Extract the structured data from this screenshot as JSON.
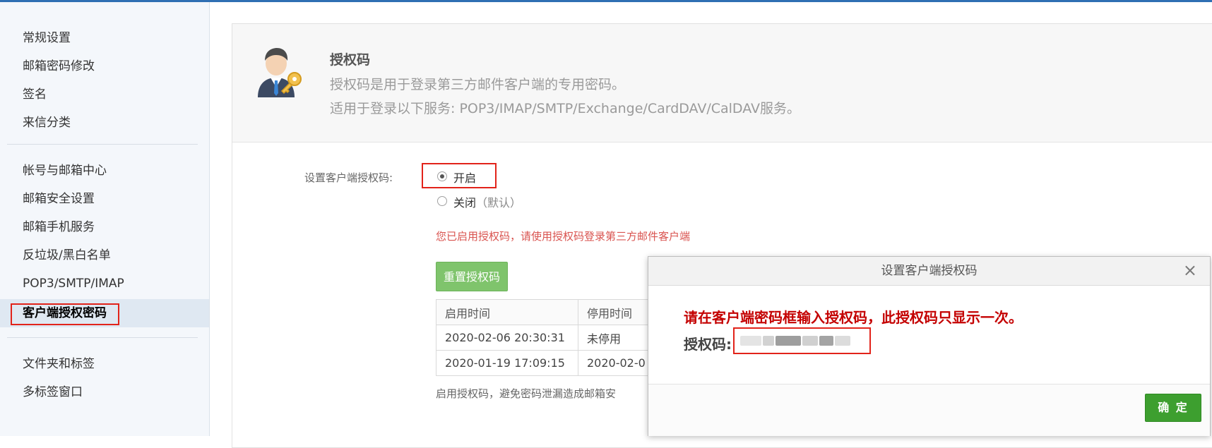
{
  "sidebar": {
    "group1": [
      "常规设置",
      "邮箱密码修改",
      "签名",
      "来信分类"
    ],
    "group2": [
      "帐号与邮箱中心",
      "邮箱安全设置",
      "邮箱手机服务",
      "反垃圾/黑白名单",
      "POP3/SMTP/IMAP",
      "客户端授权密码"
    ],
    "group3": [
      "文件夹和标签",
      "多标签窗口"
    ],
    "active": "客户端授权密码"
  },
  "header": {
    "title": "授权码",
    "desc1": "授权码是用于登录第三方邮件客户端的专用密码。",
    "desc2": "适用于登录以下服务: POP3/IMAP/SMTP/Exchange/CardDAV/CalDAV服务。"
  },
  "setting": {
    "label": "设置客户端授权码:",
    "on_label": "开启",
    "off_label": "关闭",
    "off_default": "（默认）",
    "selected": "开启",
    "notice": "您已启用授权码，请使用授权码登录第三方邮件客户端",
    "reset_button": "重置授权码"
  },
  "history_table": {
    "headers": [
      "启用时间",
      "停用时间"
    ],
    "rows": [
      [
        "2020-02-06 20:30:31",
        "未停用"
      ],
      [
        "2020-01-19 17:09:15",
        "2020-02-0"
      ]
    ]
  },
  "tip": "启用授权码，避免密码泄漏造成邮箱安",
  "modal": {
    "title": "设置客户端授权码",
    "close": "×",
    "message": "请在客户端密码框输入授权码，此授权码只显示一次。",
    "code_label": "授权码:",
    "ok_button": "确 定"
  },
  "icons": {
    "avatar": "user-key-icon",
    "close": "close-icon"
  },
  "colors": {
    "highlight_red": "#e2231a",
    "notice_red": "#d9534f",
    "ok_green": "#3d9f2f",
    "reset_green": "#7fc46c"
  }
}
